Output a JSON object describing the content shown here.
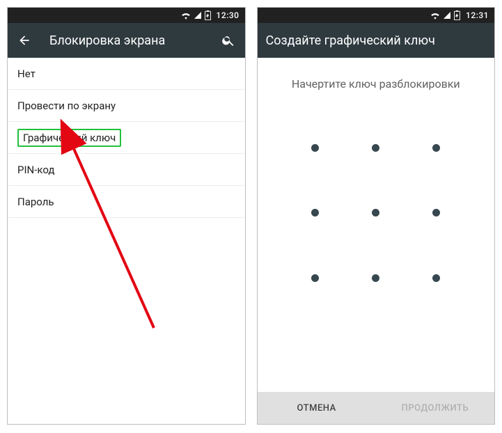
{
  "left": {
    "status_time": "12:30",
    "appbar_title": "Блокировка экрана",
    "options": [
      {
        "label": "Нет"
      },
      {
        "label": "Провести по экрану"
      },
      {
        "label": "Графический ключ",
        "highlighted": true
      },
      {
        "label": "PIN-код"
      },
      {
        "label": "Пароль"
      }
    ]
  },
  "right": {
    "status_time": "12:31",
    "appbar_title": "Создайте графический ключ",
    "instruction": "Начертите ключ разблокировки",
    "cancel_label": "ОТМЕНА",
    "continue_label": "ПРОДОЛЖИТЬ"
  }
}
